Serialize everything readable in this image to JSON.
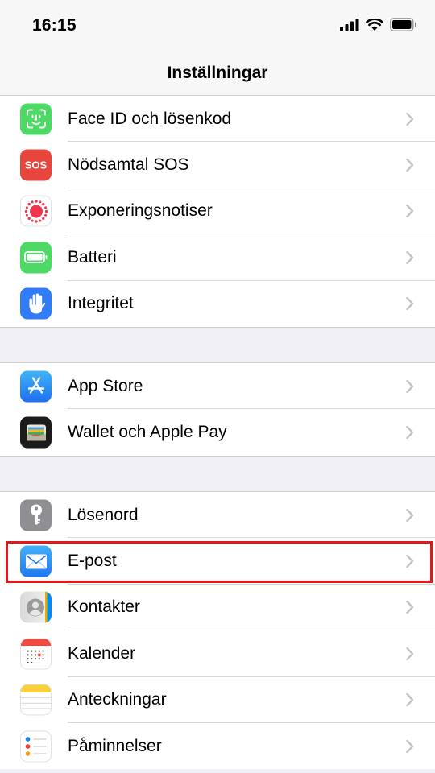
{
  "status": {
    "time": "16:15"
  },
  "nav": {
    "title": "Inställningar"
  },
  "groups": [
    {
      "items": [
        {
          "label": "Face ID och lösenkod",
          "icon": "face-id-icon"
        },
        {
          "label": "Nödsamtal SOS",
          "icon": "sos-icon",
          "badge": "SOS"
        },
        {
          "label": "Exponeringsnotiser",
          "icon": "exposure-icon"
        },
        {
          "label": "Batteri",
          "icon": "battery-icon"
        },
        {
          "label": "Integritet",
          "icon": "hand-icon"
        }
      ]
    },
    {
      "items": [
        {
          "label": "App Store",
          "icon": "app-store-icon"
        },
        {
          "label": "Wallet och Apple Pay",
          "icon": "wallet-icon"
        }
      ]
    },
    {
      "items": [
        {
          "label": "Lösenord",
          "icon": "key-icon"
        },
        {
          "label": "E-post",
          "icon": "mail-icon"
        },
        {
          "label": "Kontakter",
          "icon": "contacts-icon"
        },
        {
          "label": "Kalender",
          "icon": "calendar-icon"
        },
        {
          "label": "Anteckningar",
          "icon": "notes-icon"
        },
        {
          "label": "Påminnelser",
          "icon": "reminders-icon"
        }
      ]
    }
  ],
  "colors": {
    "highlight": "#e2191b",
    "chevron": "#c4c4c7"
  }
}
